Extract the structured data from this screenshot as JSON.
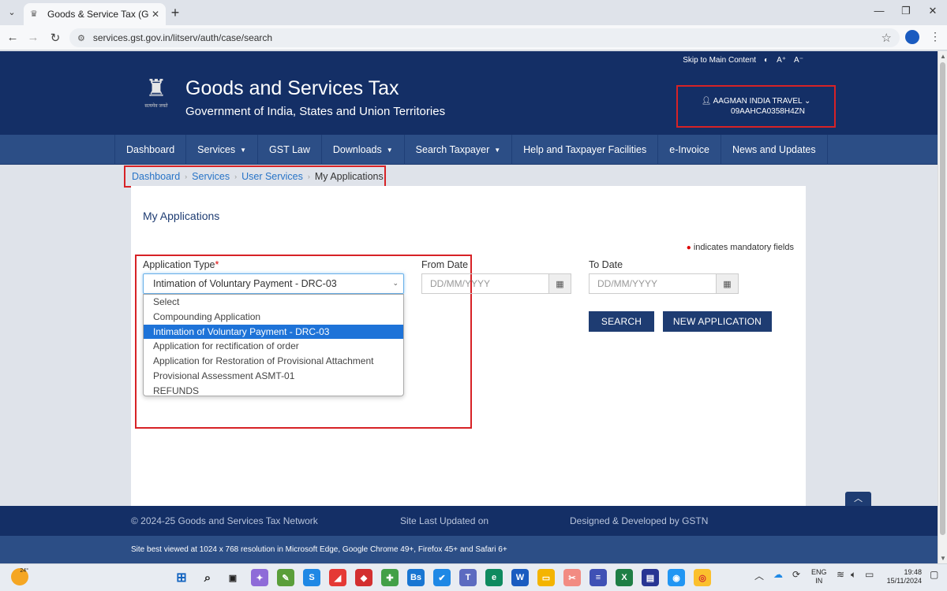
{
  "browser": {
    "tab_title": "Goods & Service Tax (GST) | User",
    "url": "services.gst.gov.in/litserv/auth/case/search"
  },
  "topbar": {
    "skip_label": "Skip to Main Content",
    "font_up": "A⁺",
    "font_down": "A⁻"
  },
  "header": {
    "title": "Goods and Services Tax",
    "subtitle": "Government of India, States and Union Territories",
    "user_name": "AAGMAN INDIA TRAVEL",
    "user_gstin": "09AAHCA0358H4ZN"
  },
  "nav": {
    "items": [
      "Dashboard",
      "Services",
      "GST Law",
      "Downloads",
      "Search Taxpayer",
      "Help and Taxpayer Facilities",
      "e-Invoice",
      "News and Updates"
    ]
  },
  "breadcrumb": {
    "items": [
      "Dashboard",
      "Services",
      "User Services"
    ],
    "current": "My Applications"
  },
  "main": {
    "title": "My Applications",
    "mandatory_note": "indicates mandatory fields",
    "app_type_label": "Application Type",
    "app_type_selected": "Intimation of Voluntary Payment - DRC-03",
    "app_type_options": [
      "Select",
      "Compounding Application",
      "Intimation of Voluntary Payment - DRC-03",
      "Application for rectification of order",
      "Application for Restoration of Provisional Attachment",
      "Provisional Assessment ASMT-01",
      "REFUNDS"
    ],
    "from_date_label": "From Date",
    "to_date_label": "To Date",
    "date_placeholder": "DD/MM/YYYY",
    "search_btn": "SEARCH",
    "new_app_btn": "NEW APPLICATION"
  },
  "footer": {
    "copyright": "© 2024-25 Goods and Services Tax Network",
    "updated": "Site Last Updated on",
    "designed": "Designed & Developed by GSTN",
    "best_viewed": "Site best viewed at 1024 x 768 resolution in Microsoft Edge, Google Chrome 49+, Firefox 45+ and Safari 6+"
  },
  "taskbar": {
    "temp": "24°",
    "lang": "ENG",
    "region": "IN",
    "time": "19:48",
    "date": "15/11/2024"
  }
}
